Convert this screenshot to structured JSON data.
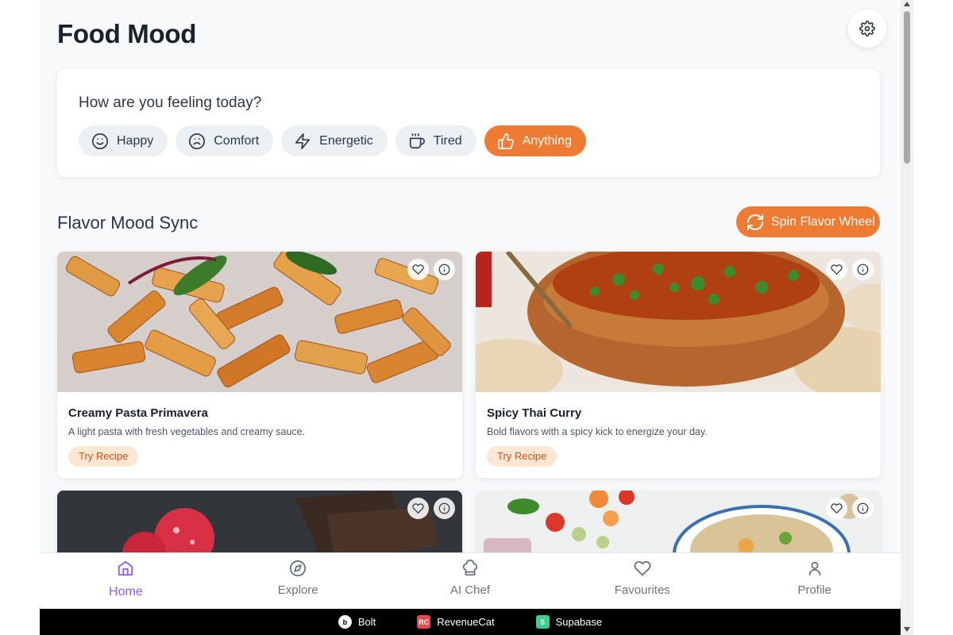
{
  "app": {
    "title": "Food Mood"
  },
  "icons": {
    "settings": "gear-icon"
  },
  "mood": {
    "question": "How are you feeling today?",
    "options": [
      {
        "label": "Happy",
        "icon": "smile-icon"
      },
      {
        "label": "Comfort",
        "icon": "frown-icon"
      },
      {
        "label": "Energetic",
        "icon": "lightning-icon"
      },
      {
        "label": "Tired",
        "icon": "coffee-cup-icon"
      },
      {
        "label": "Anything",
        "icon": "thumbs-up-icon",
        "selected": true
      }
    ]
  },
  "flavor": {
    "section_title": "Flavor Mood Sync",
    "spin_label": "Spin Flavor Wheel"
  },
  "recipes": [
    {
      "title": "Creamy Pasta Primavera",
      "description": "A light pasta with fresh vegetables and creamy sauce.",
      "action": "Try Recipe"
    },
    {
      "title": "Spicy Thai Curry",
      "description": "Bold flavors with a spicy kick to energize your day.",
      "action": "Try Recipe"
    },
    {
      "title": "",
      "description": "",
      "action": ""
    },
    {
      "title": "",
      "description": "",
      "action": ""
    }
  ],
  "nav": [
    {
      "label": "Home",
      "icon": "home-icon",
      "active": true
    },
    {
      "label": "Explore",
      "icon": "compass-icon"
    },
    {
      "label": "AI Chef",
      "icon": "chef-hat-icon"
    },
    {
      "label": "Favourites",
      "icon": "heart-icon"
    },
    {
      "label": "Profile",
      "icon": "user-icon"
    }
  ],
  "footer": {
    "brands": [
      {
        "label": "Bolt",
        "logo_text": "b"
      },
      {
        "label": "RevenueCat",
        "logo_text": "RC"
      },
      {
        "label": "Supabase",
        "logo_text": "S"
      }
    ]
  },
  "colors": {
    "accent": "#ed7b33",
    "nav_active": "#8b5cf6",
    "chip_bg": "#edf0f3",
    "try_bg": "#fde6d2"
  }
}
